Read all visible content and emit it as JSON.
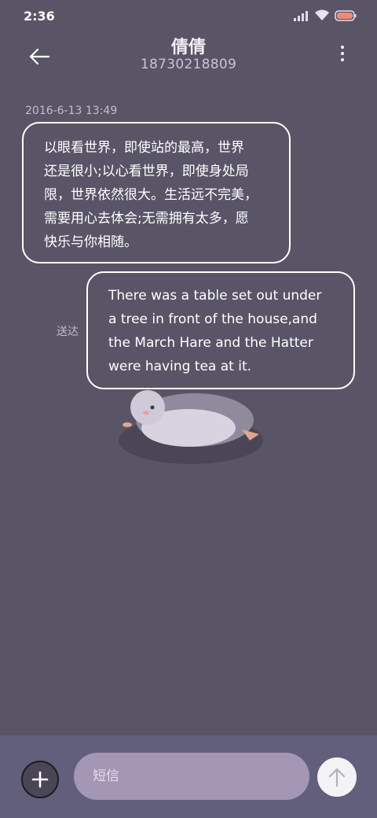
{
  "status_bar": {
    "time": "2:36",
    "icons": [
      "signal-icon",
      "wifi-icon",
      "battery-icon"
    ]
  },
  "header": {
    "contact_name": "倩倩",
    "contact_number": "18730218809",
    "back_icon": "arrow-left-icon",
    "menu_icon": "more-vertical-icon"
  },
  "conversation": {
    "timestamp": "2016-6-13 13:49",
    "messages": [
      {
        "direction": "incoming",
        "text": "以眼看世界，即使站的最高，世界\n还是很小;以心看世界，即使身处局\n限，世界依然很大。生活远不完美，\n需要用心去体会;无需拥有太多，愿\n快乐与你相随。"
      },
      {
        "direction": "outgoing",
        "text": "There was a table set out under\na tree in front of the house,and\nthe March Hare and the Hatter\nwere having tea at it.",
        "status": "送达"
      }
    ]
  },
  "composer": {
    "placeholder": "短信",
    "add_icon": "plus-icon",
    "send_icon": "arrow-up-icon"
  },
  "colors": {
    "background": "#595566",
    "bottom_bar": "#625f7c",
    "input": "#a496b5",
    "bubble_border": "#ffffff"
  }
}
